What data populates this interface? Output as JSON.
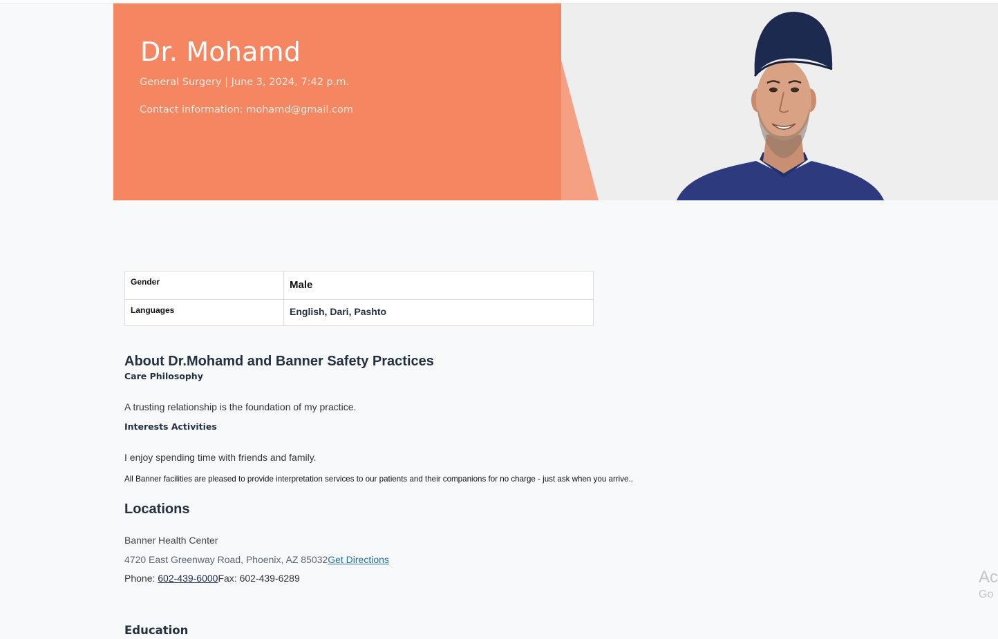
{
  "hero": {
    "name": "Dr. Mohamd",
    "subtitle": "General Surgery | June 3, 2024, 7:42 p.m.",
    "contact": "Contact information: mohamd@gmail.com",
    "accent_color": "#f48662"
  },
  "profile": {
    "rows": [
      {
        "label": "Gender",
        "value": "Male"
      },
      {
        "label": "Languages",
        "value": "English, Dari, Pashto"
      }
    ]
  },
  "about": {
    "heading": "About Dr.Mohamd and Banner Safety Practices",
    "care_heading": "Care Philosophy",
    "care_text": "A trusting relationship is the foundation of my practice.",
    "interests_heading": "Interests Activities",
    "interests_text": "I enjoy spending time with friends and family.",
    "interpretation_note": "All Banner facilities are pleased to provide interpretation services to our patients and their companions for no charge - just ask when you arrive.."
  },
  "locations": {
    "heading": "Locations",
    "name": "Banner Health Center",
    "address": "4720 East Greenway Road, Phoenix, AZ 85032",
    "directions_label": "Get Directions",
    "phone_prefix": "Phone: ",
    "phone": "602-439-6000",
    "fax": "Fax: 602-439-6289"
  },
  "education": {
    "heading": "Education"
  },
  "watermark": {
    "line1": "Ac",
    "line2": "Go"
  }
}
